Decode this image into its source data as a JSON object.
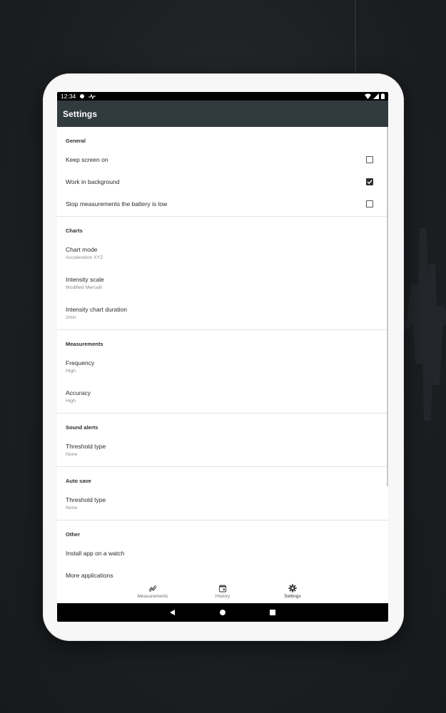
{
  "status_bar": {
    "time": "12:34"
  },
  "app_bar": {
    "title": "Settings"
  },
  "sections": [
    {
      "header": "General",
      "items": [
        {
          "title": "Keep screen on",
          "checkbox": true,
          "checked": false
        },
        {
          "title": "Work in background",
          "checkbox": true,
          "checked": true
        },
        {
          "title": "Stop measurements the battery is low",
          "checkbox": true,
          "checked": false
        }
      ]
    },
    {
      "header": "Charts",
      "items": [
        {
          "title": "Chart mode",
          "subtitle": "Acceleration XYZ"
        },
        {
          "title": "Intensity scale",
          "subtitle": "Modified Mercalli"
        },
        {
          "title": "Intensity chart duration",
          "subtitle": "2min"
        }
      ]
    },
    {
      "header": "Measurements",
      "items": [
        {
          "title": "Frequency",
          "subtitle": "High"
        },
        {
          "title": "Accuracy",
          "subtitle": "High"
        }
      ]
    },
    {
      "header": "Sound alerts",
      "items": [
        {
          "title": "Threshold type",
          "subtitle": "None"
        }
      ]
    },
    {
      "header": "Auto save",
      "items": [
        {
          "title": "Threshold type",
          "subtitle": "None"
        }
      ]
    },
    {
      "header": "Other",
      "items": [
        {
          "title": "Install app on a watch"
        },
        {
          "title": "More applications"
        }
      ]
    }
  ],
  "bottom_nav": [
    {
      "label": "Measurements",
      "icon": "chart-icon"
    },
    {
      "label": "History",
      "icon": "calendar-icon"
    },
    {
      "label": "Settings",
      "icon": "gear-icon",
      "active": true
    }
  ],
  "colors": {
    "app_bar": "#313a3f",
    "text": "#2a2a2a",
    "subtitle": "#8a8a8a"
  }
}
